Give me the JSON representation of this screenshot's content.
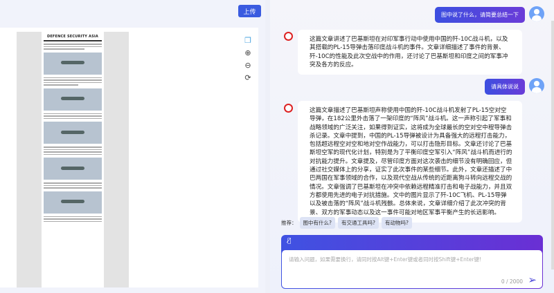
{
  "toolbar": {
    "upload_label": "上传"
  },
  "document": {
    "masthead": "DEFENCE SECURITY ASIA"
  },
  "viewer_tools": [
    "copy-icon",
    "zoom-in-icon",
    "zoom-out-icon",
    "rotate-icon"
  ],
  "chat": {
    "messages": [
      {
        "role": "user",
        "text": "图中说了什么，请简要总结一下"
      },
      {
        "role": "assistant",
        "text": "这篇文章讲述了巴基斯坦在对印军事行动中使用中国的歼-10C战斗机，以及其搭载的PL-15导弹击落印度战斗机的事件。文章详细描述了事件的背景、歼-10C的性能及此次空战中的作用，还讨论了巴基斯坦和印度之间的军事冲突及各方的反应。"
      },
      {
        "role": "user",
        "text": "请具体说说"
      },
      {
        "role": "assistant",
        "text": "这篇文章描述了巴基斯坦声称使用中国的歼-10C战斗机发射了PL-15空对空导弹，在182公里外击落了一架印度的“阵风”战斗机。这一声称引起了军事和战略领域的广泛关注，如果得到证实，这将成为全球最长的空对空中程导弹击杀记录。文章中提到，中国的PL-15导弹被设计为具备强大的远程打击能力，包括超远程空对空和地对空作战能力，可以打击隐形目标。文章还讨论了巴基斯坦空军的现代化计划，特别是为了平衡印度空军引入“阵风”战斗机而进行的对抗能力提升。文章提及，尽管印度方面对这次袭击的细节没有明确回应，但通过社交媒体上的分享，证实了此次事件的某些细节。此外，文章还描述了中巴两国在军事领域的合作，以及现代空战从传统的近距离狗斗转向远程交战的情况。文章强调了巴基斯坦在冲突中依赖远程精准打击和电子战能力，并且双方都使用先进的电子对抗措施。文中的图片显示了歼-10C飞机、PL-15导弹以及被击落的“阵风”战斗机残骸。总体来说，文章详细介绍了此次冲突的背景、双方的军事动态以及这一事件可能对地区军事平衡产生的长远影响。"
      }
    ],
    "suggest_label": "推荐：",
    "suggestions": [
      "图中有什么?",
      "有交通工具吗?",
      "有动物吗?"
    ],
    "input_placeholder": "请输入问题，如果需要换行，请同时按Alt键+Enter键或者同时按Shift键+Enter键!",
    "char_count": "0 / 2000"
  }
}
